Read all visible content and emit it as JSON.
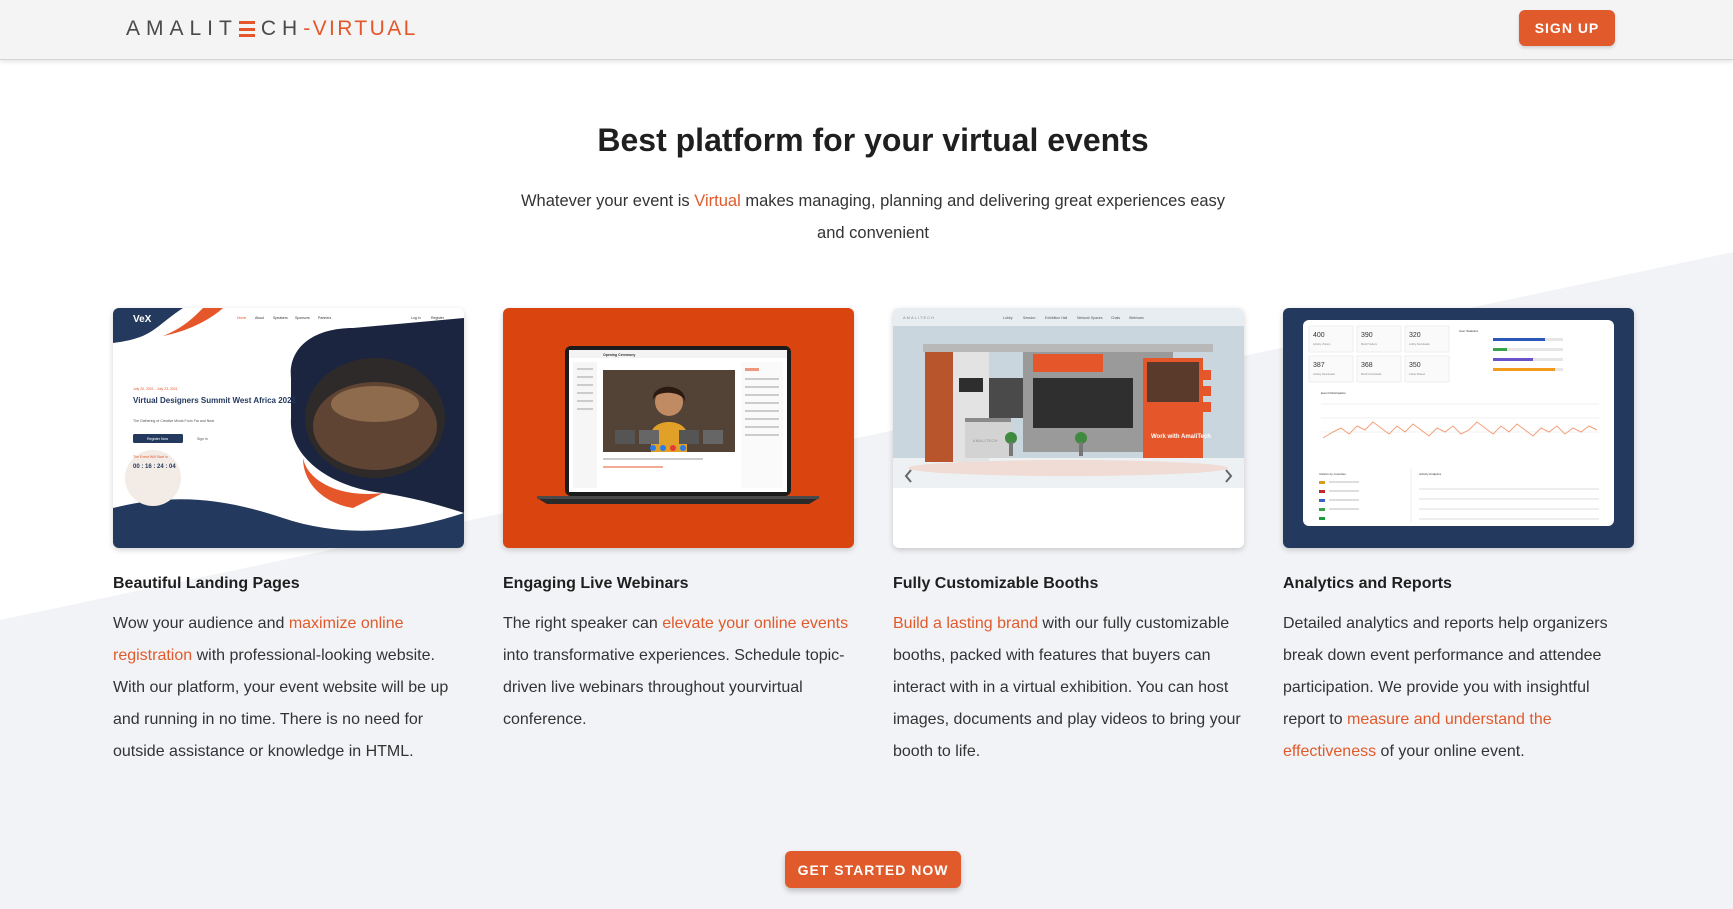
{
  "header": {
    "logo": {
      "part_a": "AMALIT",
      "part_b": "CH",
      "part_c": "-VIRTUAL"
    },
    "signup_label": "SIGN UP"
  },
  "hero": {
    "title": "Best platform for your virtual events",
    "subtitle_before": "Whatever your event is ",
    "subtitle_accent": "Virtual",
    "subtitle_after": " makes managing, planning and delivering great experiences easy and convenient"
  },
  "features": [
    {
      "title": "Beautiful Landing Pages",
      "text_before": "Wow your audience and ",
      "text_accent": "maximize online registration",
      "text_after": " with professional-looking website. With our platform, your event website will be up and running in no time. There is no need for outside assistance or knowledge in HTML.",
      "thumb": {
        "brand": "VeX",
        "nav": [
          "Home",
          "About",
          "Speakers",
          "Sponsors",
          "Partners",
          "Log in",
          "Register"
        ],
        "date": "July 20, 2021 - July 23, 2021",
        "event_title": "Virtual Designers Summit West Africa 2021",
        "event_sub": "The Gathering of Creative Minds From Far and Near",
        "register_label": "Register Now",
        "signin_label": "Sign In",
        "countdown_label": "The Event Will Start In",
        "countdown": "00 : 16 : 24 : 04"
      }
    },
    {
      "title": "Engaging Live Webinars",
      "text_before": "The right speaker can ",
      "text_accent": "elevate your online events",
      "text_after": " into transformative experiences. Schedule topic-driven live webinars throughout yourvirtual conference.",
      "thumb": {
        "webinar_title": "Opening Ceremony"
      }
    },
    {
      "title": "Fully Customizable Booths",
      "text_before": "",
      "text_accent": "Build a lasting brand",
      "text_after": " with our fully customizable booths, packed with features that buyers can interact with in a virtual exhibition. You can host images, documents and play videos to bring your booth to life.",
      "thumb": {
        "booth_logo": "AMALITECH",
        "nav": [
          "Lobby",
          "Session",
          "Exhibition Hall",
          "Network Spaces",
          "Chats",
          "Webinars"
        ],
        "poster_text": "Work with AmaliTech",
        "prev_icon": "chevron-left-icon",
        "next_icon": "chevron-right-icon"
      }
    },
    {
      "title": "Analytics and Reports",
      "text_before": "Detailed analytics and reports help organizers break down event performance and attendee participation. We provide you with insightful report to ",
      "text_accent": "measure and understand the effectiveness",
      "text_after": " of your online event.",
      "thumb": {
        "stats": [
          {
            "value": "400",
            "label": "Activity Visitors"
          },
          {
            "value": "390",
            "label": "Booth Visitors"
          },
          {
            "value": "320",
            "label": "Lobby Downloads"
          },
          {
            "value": "387",
            "label": "Activity Downloads"
          },
          {
            "value": "368",
            "label": "Booth Downloads"
          },
          {
            "value": "350",
            "label": "Cards Shared"
          }
        ],
        "user_stats_label": "User Statistics",
        "participation_label": "Event Participation",
        "by_country_label": "Visitors by countries",
        "activity_label": "Activity Analytics"
      }
    }
  ],
  "cta_label": "GET STARTED NOW",
  "colors": {
    "accent": "#e05a2b",
    "navy": "#23395d",
    "webinar_bg": "#d9440f"
  }
}
